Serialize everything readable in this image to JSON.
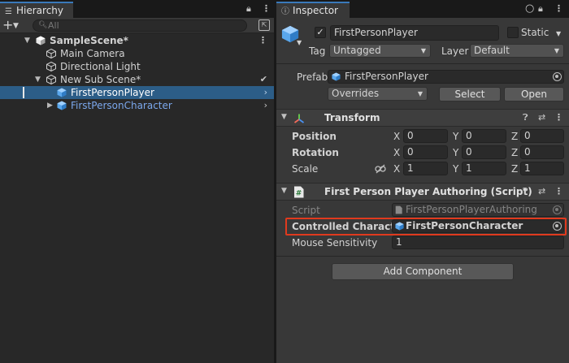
{
  "hierarchy": {
    "tab_label": "Hierarchy",
    "search_placeholder": "All",
    "rows": [
      {
        "label": "SampleScene*",
        "bold": true
      },
      {
        "label": "Main Camera"
      },
      {
        "label": "Directional Light"
      },
      {
        "label": "New Sub Scene*"
      },
      {
        "label": "FirstPersonPlayer",
        "selected": true
      },
      {
        "label": "FirstPersonCharacter"
      }
    ]
  },
  "inspector": {
    "tab_label": "Inspector",
    "object_name": "FirstPersonPlayer",
    "active_checked": true,
    "static_label": "Static",
    "tag_label": "Tag",
    "tag_value": "Untagged",
    "layer_label": "Layer",
    "layer_value": "Default",
    "prefab_label": "Prefab",
    "prefab_value": "FirstPersonPlayer",
    "overrides_label": "Overrides",
    "select_label": "Select",
    "open_label": "Open",
    "transform": {
      "title": "Transform",
      "rows": [
        {
          "label": "Position",
          "x": "0",
          "y": "0",
          "z": "0"
        },
        {
          "label": "Rotation",
          "x": "0",
          "y": "0",
          "z": "0"
        },
        {
          "label": "Scale",
          "x": "1",
          "y": "1",
          "z": "1"
        }
      ],
      "axis_x": "X",
      "axis_y": "Y",
      "axis_z": "Z"
    },
    "script_component": {
      "title": "First Person Player Authoring (Script)",
      "script_label": "Script",
      "script_value": "FirstPersonPlayerAuthoring",
      "controlled_label": "Controlled Character",
      "controlled_value": "FirstPersonCharacter",
      "mouse_label": "Mouse Sensitivity",
      "mouse_value": "1"
    },
    "add_component_label": "Add Component"
  },
  "colors": {
    "selection": "#2c5d87",
    "prefab_blue": "#7ba7ec",
    "highlight": "#e03a1e",
    "accent": "#3a79bb"
  },
  "icons": [
    "hierarchy-icon",
    "lock-icon",
    "more-icon",
    "add-icon",
    "search-icon",
    "filter-icon",
    "unity-cube-icon",
    "prefab-cube-icon",
    "inspector-icon",
    "help-icon",
    "preset-icon",
    "transform-icon",
    "script-icon",
    "object-picker-icon",
    "unlink-icon"
  ]
}
